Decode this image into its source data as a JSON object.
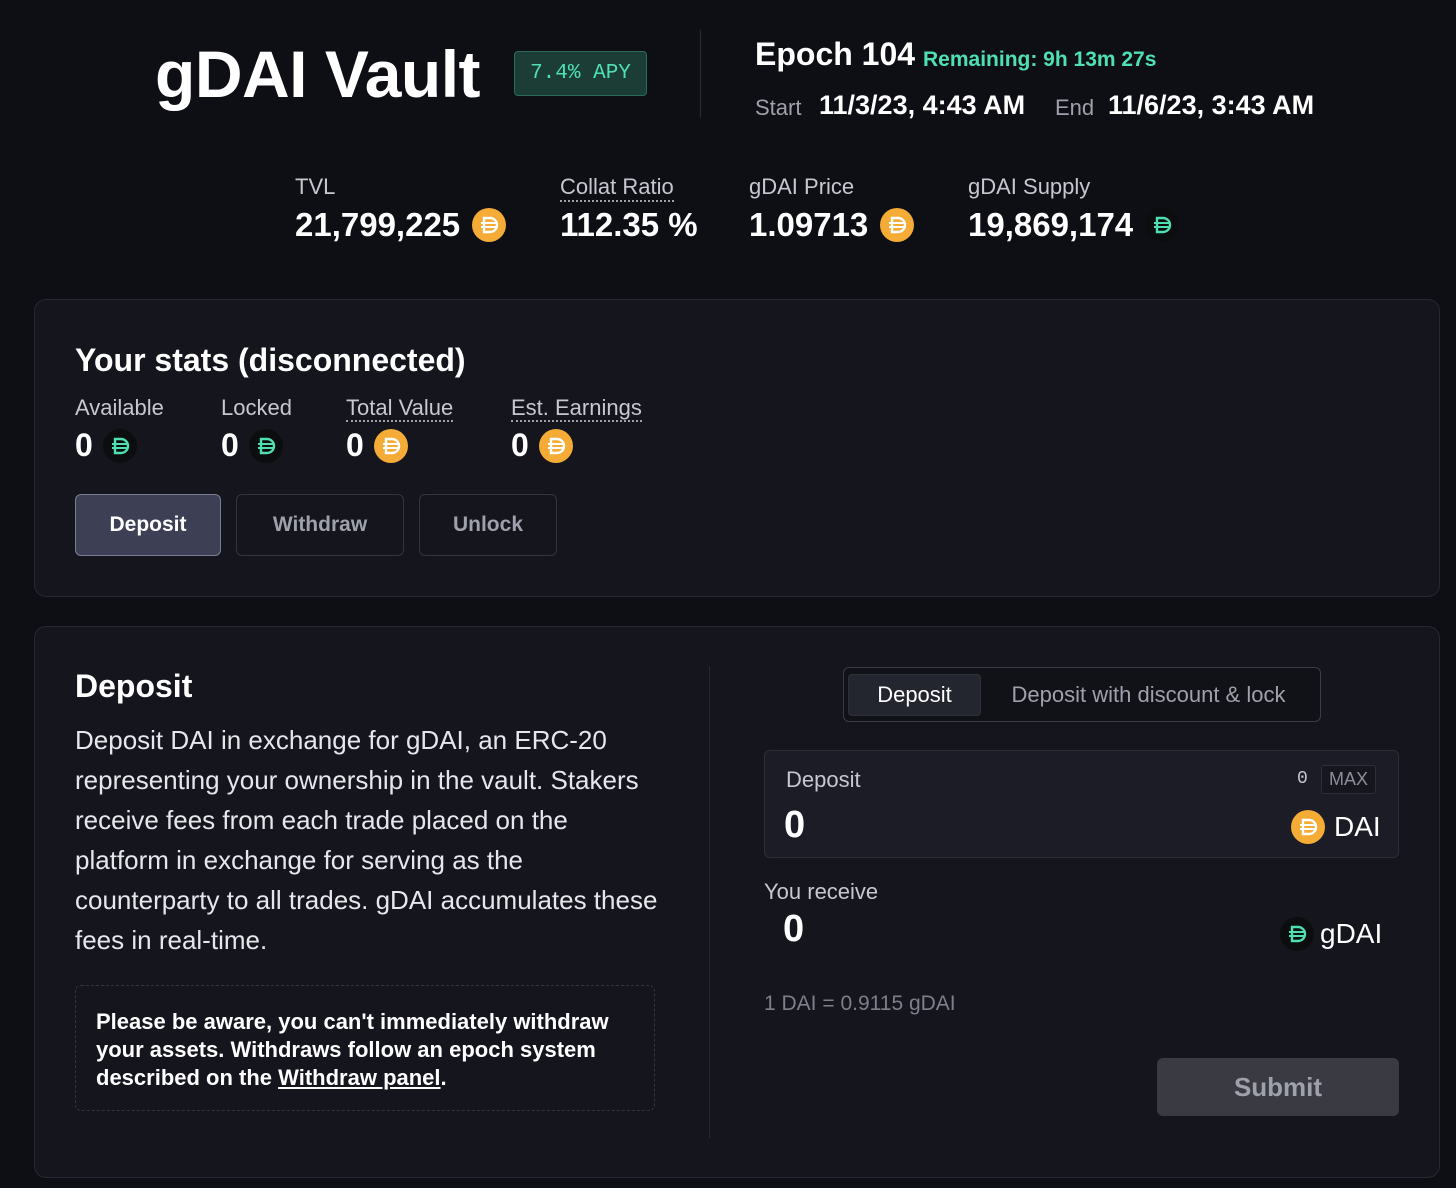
{
  "header": {
    "title": "gDAI Vault",
    "apy_badge": "7.4% APY",
    "epoch_label": "Epoch 104",
    "remaining": "Remaining: 9h 13m 27s",
    "start_label": "Start",
    "start_value": "11/3/23, 4:43 AM",
    "end_label": "End",
    "end_value": "11/6/23, 3:43 AM"
  },
  "stats": {
    "tvl_label": "TVL",
    "tvl_value": "21,799,225",
    "collat_label": "Collat Ratio",
    "collat_value": "112.35 %",
    "price_label": "gDAI Price",
    "price_value": "1.09713",
    "supply_label": "gDAI Supply",
    "supply_value": "19,869,174"
  },
  "your_stats": {
    "title": "Your stats (disconnected)",
    "available_label": "Available",
    "available_value": "0",
    "locked_label": "Locked",
    "locked_value": "0",
    "total_label": "Total Value",
    "total_value": "0",
    "earnings_label": "Est. Earnings",
    "earnings_value": "0",
    "tabs": {
      "deposit": "Deposit",
      "withdraw": "Withdraw",
      "unlock": "Unlock"
    }
  },
  "deposit_panel": {
    "title": "Deposit",
    "description": "Deposit DAI in exchange for gDAI, an ERC-20 representing your ownership in the vault. Stakers receive fees from each trade placed on the platform in exchange for serving as the counterparty to all trades. gDAI accumulates these fees in real-time.",
    "notice_text": "Please be aware, you can't immediately withdraw your assets. Withdraws follow an epoch system described on the ",
    "notice_link": "Withdraw panel",
    "notice_end": ".",
    "mode_tabs": {
      "deposit": "Deposit",
      "deposit_lock": "Deposit with discount & lock"
    },
    "input_label": "Deposit",
    "balance": "0",
    "max_label": "MAX",
    "input_value": "0",
    "input_token": "DAI",
    "receive_label": "You receive",
    "receive_value": "0",
    "receive_token": "gDAI",
    "rate": "1 DAI = 0.9115 gDAI",
    "submit_label": "Submit"
  },
  "colors": {
    "background": "#0e0f15",
    "card": "#14151d",
    "accent_green": "#4fe0b2",
    "dai_orange": "#f5ac37"
  },
  "icons": {
    "dai": "dai-coin-icon",
    "gdai": "gdai-coin-icon"
  }
}
